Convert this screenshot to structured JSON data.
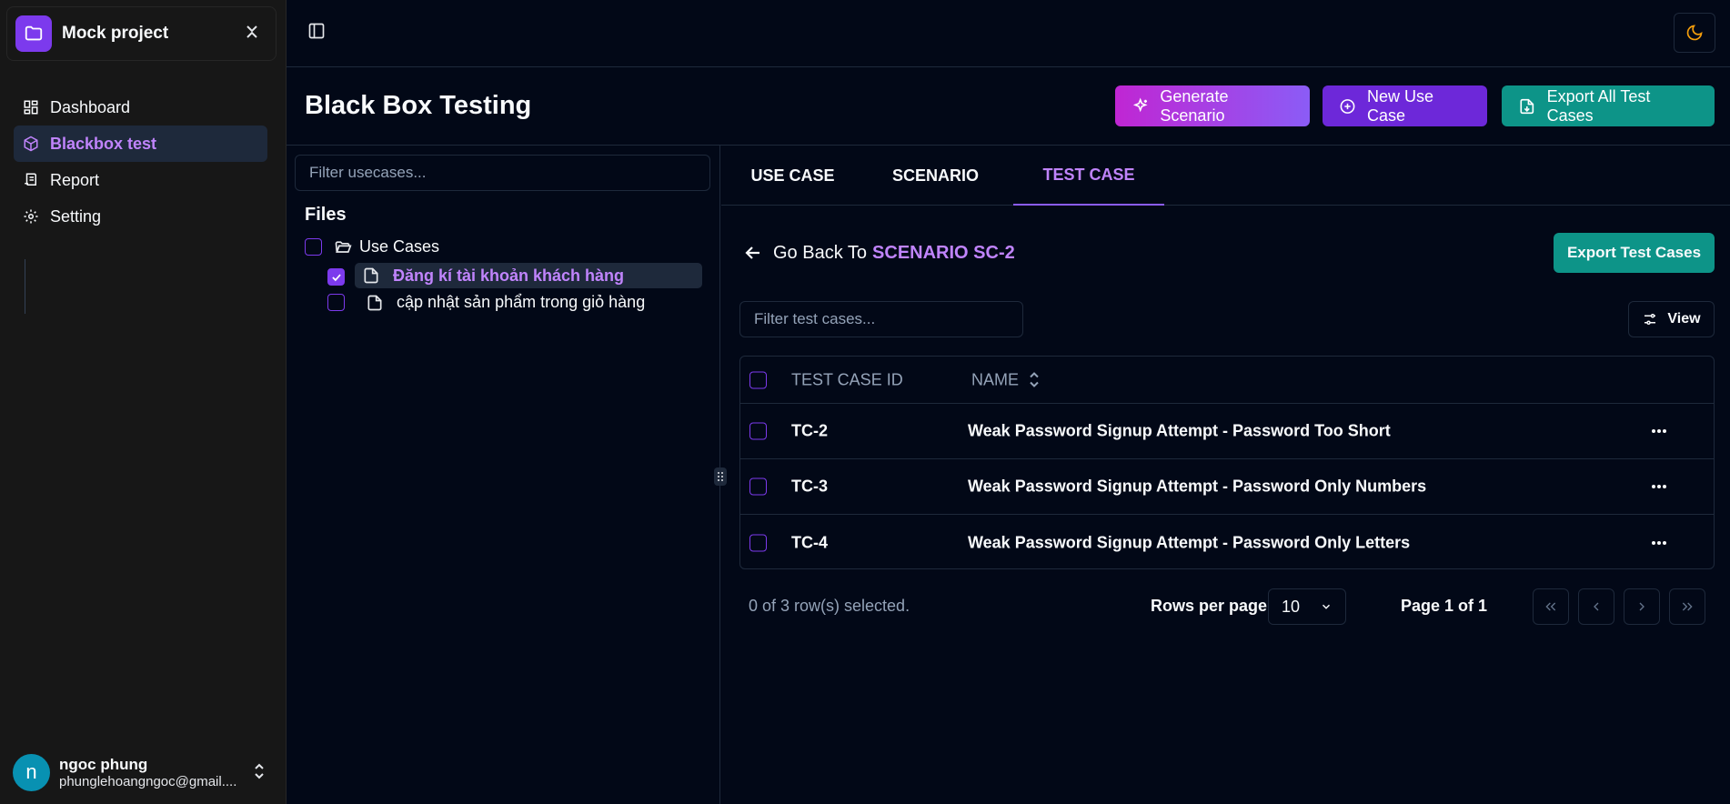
{
  "sidebar": {
    "project_name": "Mock project",
    "nav": [
      {
        "label": "Dashboard",
        "icon": "dashboard-icon"
      },
      {
        "label": "Blackbox test",
        "icon": "box-icon",
        "active": true
      },
      {
        "label": "Report",
        "icon": "report-icon"
      },
      {
        "label": "Setting",
        "icon": "gear-icon"
      }
    ],
    "user": {
      "initial": "n",
      "name": "ngoc phung",
      "email": "phunglehoangngoc@gmail...."
    }
  },
  "header": {
    "title": "Black Box Testing",
    "buttons": {
      "generate": "Generate Scenario",
      "new_use_case": "New Use Case",
      "export_all": "Export All Test Cases"
    }
  },
  "files": {
    "filter_placeholder": "Filter usecases...",
    "heading": "Files",
    "folder": "Use Cases",
    "items": [
      {
        "label": "Đăng kí tài khoản khách hàng",
        "checked": true
      },
      {
        "label": "cập nhật sản phẩm trong giỏ hàng",
        "checked": false
      }
    ]
  },
  "tabs": [
    "USE CASE",
    "SCENARIO",
    "TEST CASE"
  ],
  "active_tab": "TEST CASE",
  "back": {
    "prefix": "Go Back To",
    "target": "SCENARIO SC-2"
  },
  "export_test_cases": "Export Test Cases",
  "filter_tc_placeholder": "Filter test cases...",
  "view_label": "View",
  "table": {
    "headers": {
      "id": "TEST CASE ID",
      "name": "NAME"
    },
    "rows": [
      {
        "id": "TC-2",
        "name": "Weak Password Signup Attempt - Password Too Short"
      },
      {
        "id": "TC-3",
        "name": "Weak Password Signup Attempt - Password Only Numbers"
      },
      {
        "id": "TC-4",
        "name": "Weak Password Signup Attempt - Password Only Letters"
      }
    ]
  },
  "pager": {
    "selected": "0 of 3 row(s) selected.",
    "rows_per_page_label": "Rows per page",
    "rows_per_page": "10",
    "page_label": "Page 1 of 1"
  },
  "colors": {
    "accent": "#8b5cf6",
    "teal": "#0d9488",
    "background": "#020817",
    "sidebar": "#171717"
  }
}
